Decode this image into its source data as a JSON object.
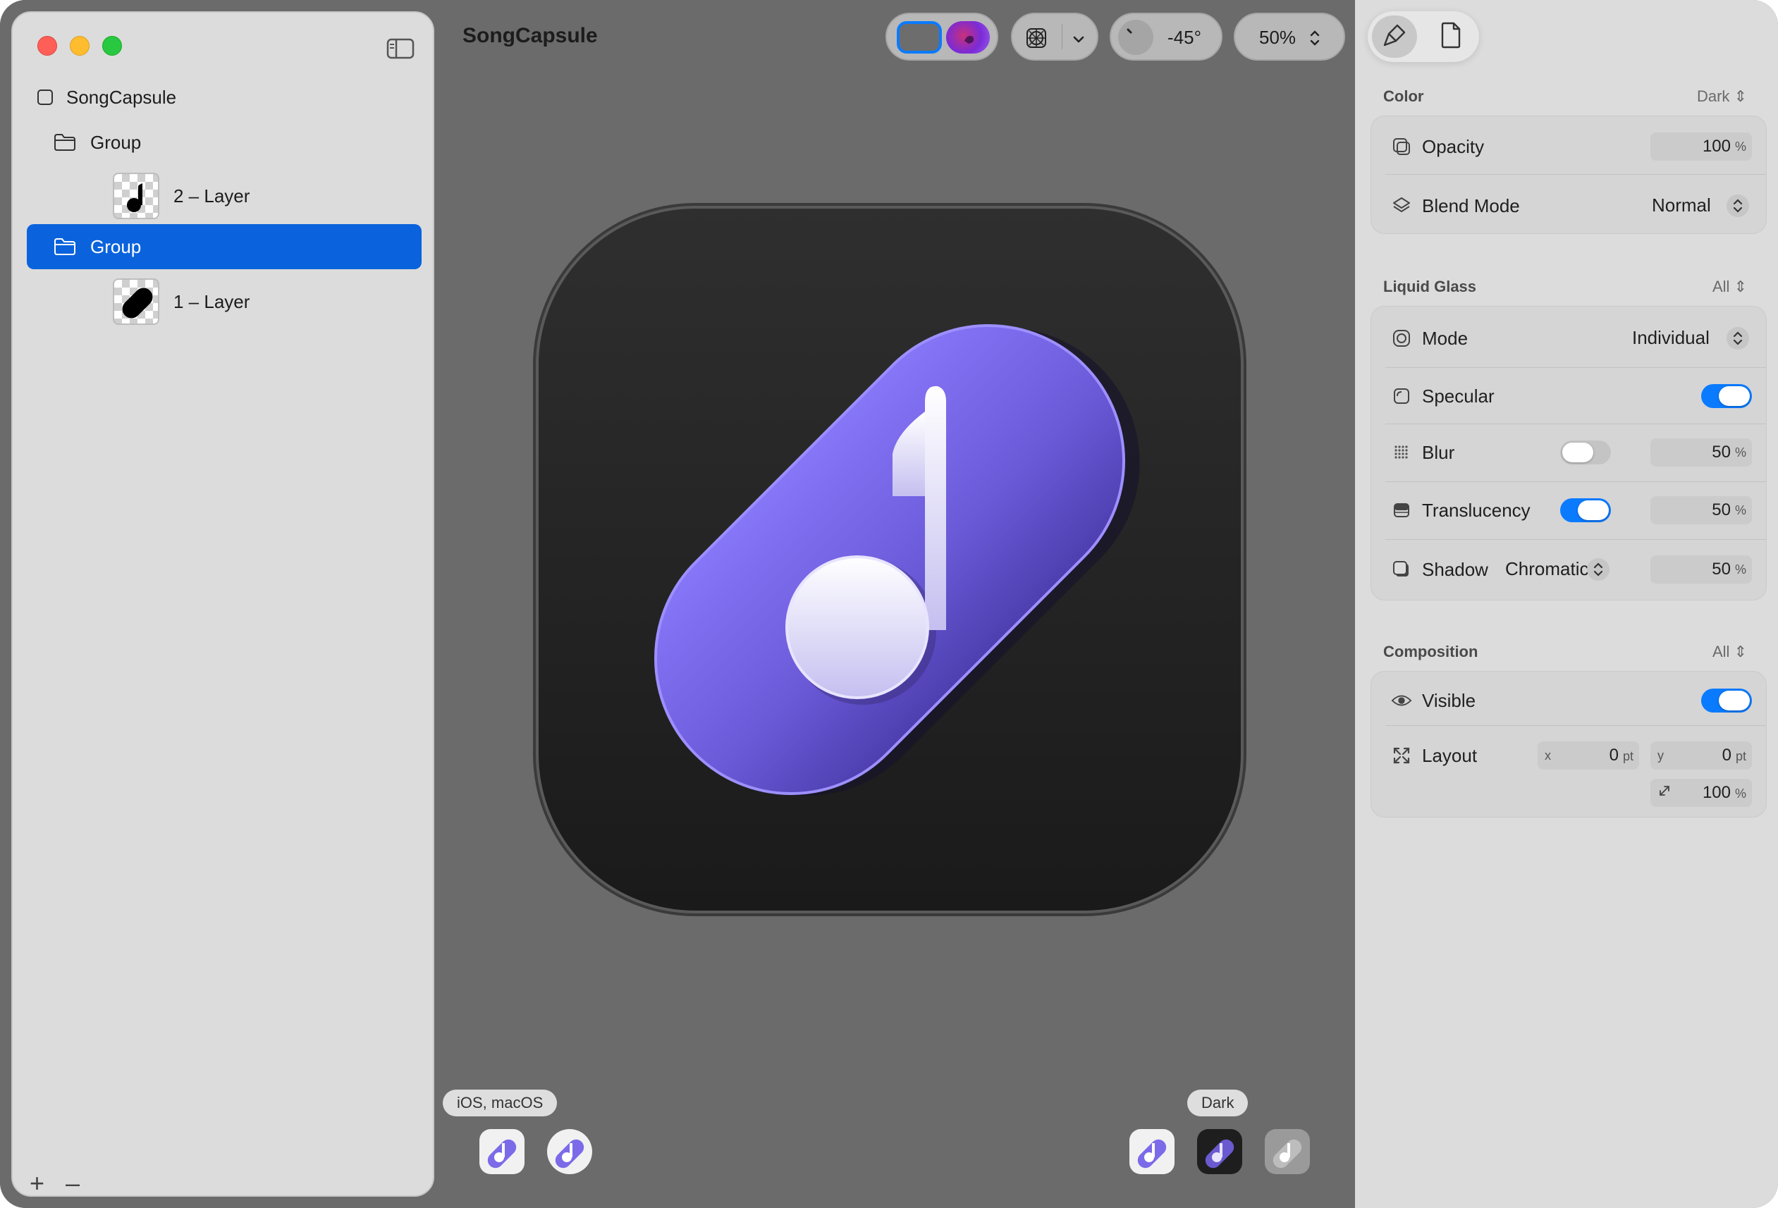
{
  "window": {
    "title": "SongCapsule"
  },
  "sidebar": {
    "items": [
      {
        "label": "SongCapsule"
      },
      {
        "label": "Group"
      },
      {
        "label": "2 – Layer"
      },
      {
        "label": "Group"
      },
      {
        "label": "1 – Layer"
      }
    ],
    "add_label": "+",
    "remove_label": "–"
  },
  "toolbar": {
    "angle": "-45°",
    "zoom": "50%"
  },
  "previews": {
    "left_tag": "iOS, macOS",
    "right_tag": "Dark"
  },
  "inspector": {
    "color": {
      "title": "Color",
      "menu": "Dark",
      "opacity_label": "Opacity",
      "opacity_value": "100",
      "opacity_unit": "%",
      "blend_label": "Blend Mode",
      "blend_value": "Normal"
    },
    "liquid_glass": {
      "title": "Liquid Glass",
      "menu": "All",
      "mode_label": "Mode",
      "mode_value": "Individual",
      "specular_label": "Specular",
      "specular_on": true,
      "blur_label": "Blur",
      "blur_on": false,
      "blur_value": "50",
      "translucency_label": "Translucency",
      "translucency_on": true,
      "translucency_value": "50",
      "shadow_label": "Shadow",
      "shadow_mode": "Chromatic",
      "shadow_value": "50",
      "unit": "%"
    },
    "composition": {
      "title": "Composition",
      "menu": "All",
      "visible_label": "Visible",
      "visible_on": true,
      "layout_label": "Layout",
      "x_label": "x",
      "x_value": "0",
      "y_label": "y",
      "y_value": "0",
      "pt_unit": "pt",
      "scale_value": "100",
      "scale_unit": "%"
    }
  },
  "colors": {
    "accent": "#0a63dd",
    "toggle_on": "#0a7bff",
    "capsule_top": "#8676f8",
    "capsule_bottom": "#4e3fb0"
  }
}
